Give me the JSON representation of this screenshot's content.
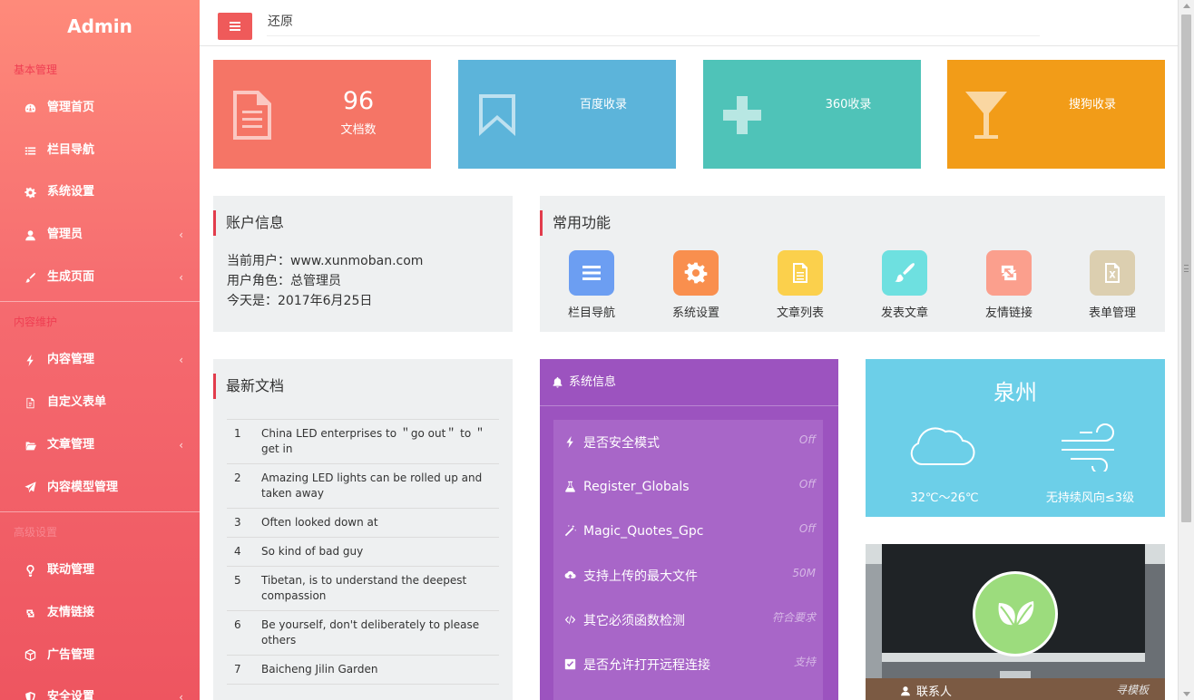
{
  "brand": "Admin",
  "topbar": {
    "restore_text": "还原"
  },
  "sidebar": {
    "sections": [
      {
        "title": "基本管理",
        "items": [
          {
            "label": "管理首页",
            "icon": "dashboard-icon"
          },
          {
            "label": "栏目导航",
            "icon": "list-icon"
          },
          {
            "label": "系统设置",
            "icon": "gear-icon"
          },
          {
            "label": "管理员",
            "icon": "user-icon",
            "expandable": true
          },
          {
            "label": "生成页面",
            "icon": "brush-icon",
            "expandable": true
          }
        ]
      },
      {
        "title": "内容维护",
        "items": [
          {
            "label": "内容管理",
            "icon": "bolt-icon",
            "expandable": true
          },
          {
            "label": "自定义表单",
            "icon": "file-icon"
          },
          {
            "label": "文章管理",
            "icon": "folder-icon",
            "expandable": true
          },
          {
            "label": "内容模型管理",
            "icon": "paper-plane-icon"
          }
        ]
      },
      {
        "title": "高级设置",
        "items": [
          {
            "label": "联动管理",
            "icon": "lightbulb-icon"
          },
          {
            "label": "友情链接",
            "icon": "retweet-icon"
          },
          {
            "label": "广告管理",
            "icon": "cube-icon"
          },
          {
            "label": "安全设置",
            "icon": "shield-icon",
            "expandable": true
          }
        ]
      }
    ]
  },
  "tiles": [
    {
      "number": "96",
      "label": "文档数",
      "color": "#f57566",
      "icon": "document-icon"
    },
    {
      "label": "百度收录",
      "color": "#5cb4da",
      "icon": "bookmark-icon"
    },
    {
      "label": "360收录",
      "color": "#4fc3b8",
      "icon": "plus-icon"
    },
    {
      "label": "搜狗收录",
      "color": "#f29c18",
      "icon": "cocktail-icon"
    }
  ],
  "account": {
    "title": "账户信息",
    "user_line": "当前用户：www.xunmoban.com",
    "role_line": "用户角色：总管理员",
    "date_line": "今天是：2017年6月25日"
  },
  "functions": {
    "title": "常用功能",
    "items": [
      {
        "label": "栏目导航",
        "color": "#6c9ef2",
        "icon": "list-icon"
      },
      {
        "label": "系统设置",
        "color": "#f98f4e",
        "icon": "gear-icon"
      },
      {
        "label": "文章列表",
        "color": "#fbd04c",
        "icon": "document-icon"
      },
      {
        "label": "发表文章",
        "color": "#6ee0e0",
        "icon": "brush-icon"
      },
      {
        "label": "友情链接",
        "color": "#fb9f8d",
        "icon": "retweet-icon"
      },
      {
        "label": "表单管理",
        "color": "#dccfb0",
        "icon": "excel-icon"
      }
    ]
  },
  "docs": {
    "title": "最新文档",
    "rows": [
      {
        "num": "1",
        "text": "China LED enterprises to ＂go out＂ to ＂get in"
      },
      {
        "num": "2",
        "text": "Amazing LED lights can be rolled up and taken away"
      },
      {
        "num": "3",
        "text": "Often looked down at"
      },
      {
        "num": "4",
        "text": "So kind of bad guy"
      },
      {
        "num": "5",
        "text": "Tibetan, is to understand the deepest compassion"
      },
      {
        "num": "6",
        "text": "Be yourself, don't deliberately to please others"
      },
      {
        "num": "7",
        "text": "Baicheng Jilin Garden"
      }
    ]
  },
  "sysinfo": {
    "title": "系统信息",
    "rows": [
      {
        "label": "是否安全模式",
        "value": "Off",
        "icon": "bolt-icon"
      },
      {
        "label": "Register_Globals",
        "value": "Off",
        "icon": "flask-icon"
      },
      {
        "label": "Magic_Quotes_Gpc",
        "value": "Off",
        "icon": "magic-icon"
      },
      {
        "label": "支持上传的最大文件",
        "value": "50M",
        "icon": "cloud-upload-icon"
      },
      {
        "label": "其它必须函数检测",
        "value": "符合要求",
        "icon": "code-icon"
      },
      {
        "label": "是否允许打开远程连接",
        "value": "支持",
        "icon": "checkbox-icon"
      }
    ]
  },
  "weather": {
    "city": "泉州",
    "temp": "32℃～26℃",
    "wind": "无持续风向≤3级"
  },
  "contact": {
    "name": "联系人",
    "right_text": "寻模板"
  }
}
